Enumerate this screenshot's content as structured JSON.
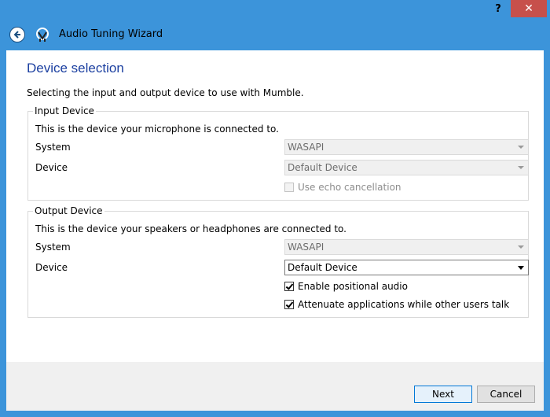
{
  "window": {
    "title": "Audio Tuning Wizard",
    "help_label": "?",
    "close_label": "✕"
  },
  "page": {
    "heading": "Device selection",
    "description": "Selecting the input and output device to use with Mumble."
  },
  "input": {
    "group_title": "Input Device",
    "info": "This is the device your microphone is connected to.",
    "system_label": "System",
    "system_value": "WASAPI",
    "device_label": "Device",
    "device_value": "Default Device",
    "echo_label": "Use echo cancellation",
    "echo_checked": false
  },
  "output": {
    "group_title": "Output Device",
    "info": "This is the device your speakers or headphones are connected to.",
    "system_label": "System",
    "system_value": "WASAPI",
    "device_label": "Device",
    "device_value": "Default Device",
    "positional_label": "Enable positional audio",
    "positional_checked": true,
    "attenuate_label": "Attenuate applications while other users talk",
    "attenuate_checked": true
  },
  "buttons": {
    "next": "Next",
    "cancel": "Cancel"
  },
  "colors": {
    "titlebar": "#3c94da",
    "close": "#c7504b",
    "heading": "#1b3fa0"
  },
  "icons": {
    "back": "back-arrow-icon",
    "logo": "mumble-logo-icon"
  }
}
